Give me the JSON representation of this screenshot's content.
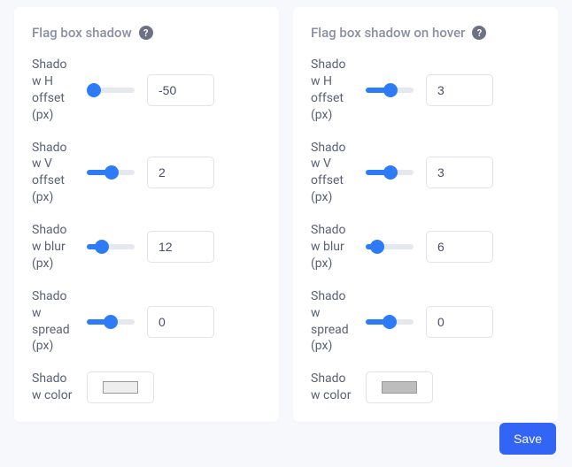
{
  "left": {
    "title": "Flag box shadow",
    "help_icon": "?",
    "rows": {
      "h": {
        "label": "Shadow H offset (px)",
        "value": "-50",
        "slider": {
          "min": -50,
          "max": 50,
          "val": -50
        }
      },
      "v": {
        "label": "Shadow V offset (px)",
        "value": "2",
        "slider": {
          "min": -50,
          "max": 50,
          "val": 2
        }
      },
      "blur": {
        "label": "Shadow blur (px)",
        "value": "12",
        "slider": {
          "min": 0,
          "max": 50,
          "val": 12
        }
      },
      "spread": {
        "label": "Shadow spread (px)",
        "value": "0",
        "slider": {
          "min": -50,
          "max": 50,
          "val": 0
        }
      },
      "color": {
        "label": "Shadow color",
        "swatch": "#eeeeee"
      }
    }
  },
  "right": {
    "title": "Flag box shadow on hover",
    "help_icon": "?",
    "rows": {
      "h": {
        "label": "Shadow H offset (px)",
        "value": "3",
        "slider": {
          "min": -50,
          "max": 50,
          "val": 3
        }
      },
      "v": {
        "label": "Shadow V offset (px)",
        "value": "3",
        "slider": {
          "min": -50,
          "max": 50,
          "val": 3
        }
      },
      "blur": {
        "label": "Shadow blur (px)",
        "value": "6",
        "slider": {
          "min": 0,
          "max": 50,
          "val": 6
        }
      },
      "spread": {
        "label": "Shadow spread (px)",
        "value": "0",
        "slider": {
          "min": -50,
          "max": 50,
          "val": 0
        }
      },
      "color": {
        "label": "Shadow color",
        "swatch": "#bdbdbd"
      }
    }
  },
  "actions": {
    "save": "Save"
  },
  "colors": {
    "accent": "#2d7bf6",
    "button": "#3264f5"
  }
}
